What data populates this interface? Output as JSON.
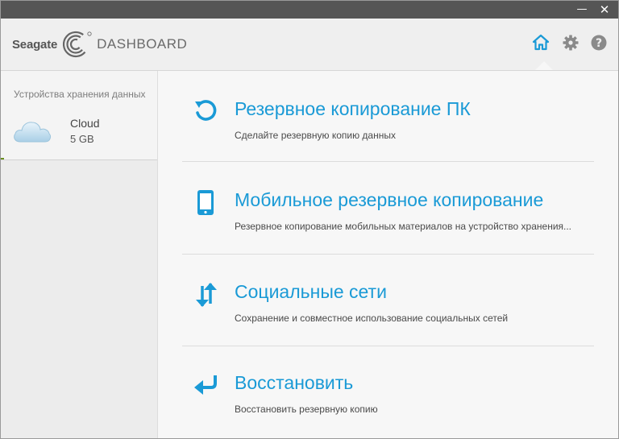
{
  "window": {
    "minimize_glyph": "—",
    "close_glyph": "✕"
  },
  "header": {
    "brand": "Seagate",
    "product": "DASHBOARD",
    "icons": [
      "home-icon",
      "gear-icon",
      "help-icon"
    ],
    "active_icon": "home-icon"
  },
  "colors": {
    "accent": "#1a9ad6",
    "titlebar": "#555555",
    "header_bg": "#efefef",
    "sidebar_bg": "#ececec"
  },
  "sidebar": {
    "heading": "Устройства хранения данных",
    "devices": [
      {
        "name": "Cloud",
        "size": "5 GB",
        "icon": "cloud-icon"
      }
    ]
  },
  "actions": [
    {
      "title": "Резервное копирование ПК",
      "description": "Сделайте резервную копию данных",
      "icon": "backup-refresh-icon"
    },
    {
      "title": "Мобильное резервное копирование",
      "description": "Резервное копирование мобильных материалов на устройство хранения...",
      "icon": "mobile-phone-icon"
    },
    {
      "title": "Социальные сети",
      "description": "Сохранение и совместное использование социальных сетей",
      "icon": "sync-arrows-icon"
    },
    {
      "title": "Восстановить",
      "description": "Восстановить резервную копию",
      "icon": "restore-arrow-icon"
    }
  ]
}
